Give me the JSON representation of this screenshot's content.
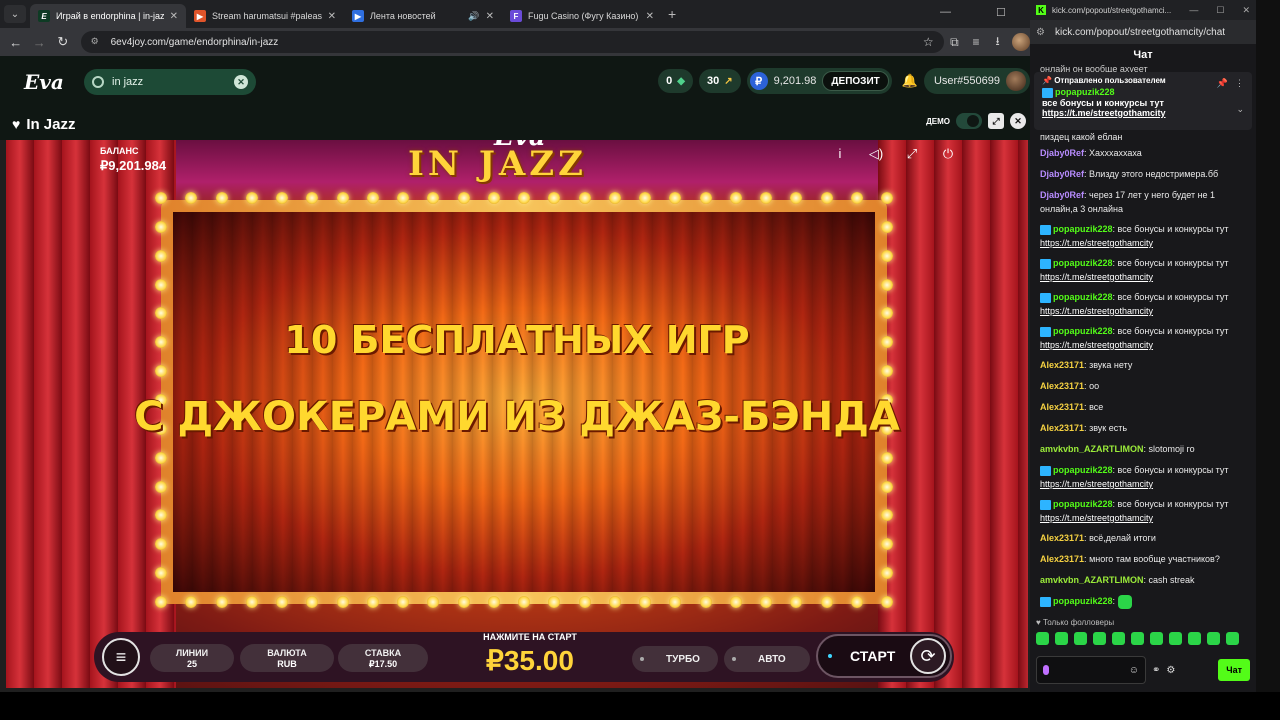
{
  "browser": {
    "tabs": [
      {
        "title": "Играй в endorphina | in-jazz E",
        "active": true
      },
      {
        "title": "Stream harumatsui #paleasther"
      },
      {
        "title": "Лента новостей"
      },
      {
        "title": "Fugu Casino (Фугу Казино) - р"
      }
    ],
    "url": "6ev4joy.com/game/endorphina/in-jazz"
  },
  "site": {
    "logo": "Eva",
    "search_value": "in jazz",
    "bonus_count": "0",
    "freespins_count": "30",
    "balance": "9,201.98",
    "balance_currency_icon": "₽",
    "deposit_label": "ДЕПОЗИТ",
    "username": "User#550699",
    "game_title": "In Jazz",
    "demo_label": "ДЕМО"
  },
  "game": {
    "balance_label": "БАЛАНС",
    "balance_value": "₽9,201.984",
    "logo_small": "Eva",
    "logo_main": "IN JAZZ",
    "message_line1": "10 БЕСПЛАТНЫХ ИГР",
    "message_line2": "С ДЖОКЕРАМИ ИЗ ДЖАЗ-БЭНДА",
    "lines_label": "ЛИНИИ",
    "lines_value": "25",
    "currency_label": "ВАЛЮТА",
    "currency_value": "RUB",
    "stake_label": "СТАВКА",
    "stake_value": "₽17.50",
    "press_start_label": "НАЖМИТЕ НА СТАРТ",
    "total_bet": "₽35.00",
    "turbo_label": "ТУРБО",
    "auto_label": "АВТО",
    "start_label": "СТАРТ"
  },
  "chat": {
    "window_url_short": "kick.com/popout/streetgothamci...",
    "url": "kick.com/popout/streetgothamcity/chat",
    "title": "Чат",
    "truncated_top": "онлайн он вообще ахуеет",
    "pinned_header": "Отправлено пользователем",
    "pinned_user": "popapuzik228",
    "pinned_text": "все бонусы и конкурсы тут",
    "pinned_link": "https://t.me/streetgothamcity",
    "messages": [
      {
        "user": "",
        "text": "пиздец какой еблан"
      },
      {
        "user": "Djaby0Ref",
        "text": "Хахххаххаха"
      },
      {
        "user": "Djaby0Ref",
        "text": "Влизду этого недостримера.бб"
      },
      {
        "user": "Djaby0Ref",
        "text": "через 17 лет у него будет не 1 онлайн,а 3 онлайна"
      },
      {
        "user": "popapuzik228",
        "text": "все бонусы и конкурсы тут",
        "link": "https://t.me/streetgothamcity"
      },
      {
        "user": "popapuzik228",
        "text": "все бонусы и конкурсы тут",
        "link": "https://t.me/streetgothamcity"
      },
      {
        "user": "popapuzik228",
        "text": "все бонусы и конкурсы тут",
        "link": "https://t.me/streetgothamcity"
      },
      {
        "user": "popapuzik228",
        "text": "все бонусы и конкурсы тут",
        "link": "https://t.me/streetgothamcity"
      },
      {
        "user": "Alex23171",
        "text": "звука нету"
      },
      {
        "user": "Alex23171",
        "text": "оо"
      },
      {
        "user": "Alex23171",
        "text": "все"
      },
      {
        "user": "Alex23171",
        "text": "звук есть"
      },
      {
        "user": "amvkvbn_AZARTLIMON",
        "text": "slotomoji го"
      },
      {
        "user": "popapuzik228",
        "text": "все бонусы и конкурсы тут",
        "link": "https://t.me/streetgothamcity"
      },
      {
        "user": "popapuzik228",
        "text": "все бонусы и конкурсы тут",
        "link": "https://t.me/streetgothamcity"
      },
      {
        "user": "Alex23171",
        "text": "всё,делай итоги"
      },
      {
        "user": "Alex23171",
        "text": "много там вообще участников?"
      },
      {
        "user": "amvkvbn_AZARTLIMON",
        "text": "cash streak"
      },
      {
        "user": "popapuzik228",
        "text": ""
      }
    ],
    "followers_only": "Только фолловеры",
    "send_label": "Чат"
  }
}
